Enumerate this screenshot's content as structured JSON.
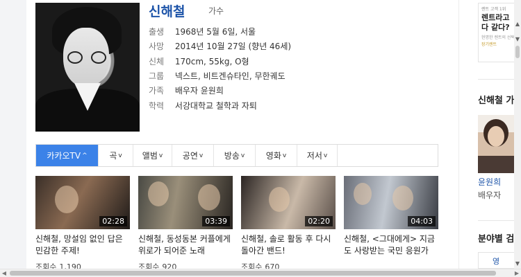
{
  "profile": {
    "name": "신해철",
    "job": "가수",
    "info": [
      {
        "key": "출생",
        "value": "1968년 5월 6일, 서울"
      },
      {
        "key": "사망",
        "value": "2014년 10월 27일 (향년 46세)"
      },
      {
        "key": "신체",
        "value": "170cm, 55kg, O형"
      },
      {
        "key": "그룹",
        "value": "넥스트, 비트겐슈타인, 무한궤도"
      },
      {
        "key": "가족",
        "value": "배우자 윤원희"
      },
      {
        "key": "학력",
        "value": "서강대학교 철학과 자퇴"
      }
    ]
  },
  "tabs": [
    {
      "label": "카카오TV",
      "chevron": "^",
      "active": true
    },
    {
      "label": "곡",
      "chevron": "v"
    },
    {
      "label": "앨범",
      "chevron": "v"
    },
    {
      "label": "공연",
      "chevron": "v"
    },
    {
      "label": "방송",
      "chevron": "v"
    },
    {
      "label": "영화",
      "chevron": "v"
    },
    {
      "label": "저서",
      "chevron": "v"
    }
  ],
  "videos": [
    {
      "title": "신해철, 망설임 없인 답은 민감한 주제!",
      "duration": "02:28",
      "views_label": "조회수",
      "views": "1,190"
    },
    {
      "title": "신해철, 동성동본 커플에게 위로가 되어준 노래",
      "duration": "03:39",
      "views_label": "조회수",
      "views": "920"
    },
    {
      "title": "신해철, 솔로 활동 후 다시 돌아간 밴드!",
      "duration": "02:20",
      "views_label": "조회수",
      "views": "670"
    },
    {
      "title": "신해철, <그대에게> 지금도 사랑받는 국민 응원가 ...",
      "duration": "04:03",
      "views_label": "",
      "views": ""
    }
  ],
  "right": {
    "ad_top": "렌트 고객 1위",
    "ad_main": "렌트라고\n다 같다?",
    "ad_sub": "현명한 렌트의 선택",
    "ad_brand": "장기렌트",
    "section1": "신해철 가",
    "spouse_name": "윤원희",
    "spouse_role": "배우자",
    "section2": "분야별 검",
    "box_text": "영"
  }
}
